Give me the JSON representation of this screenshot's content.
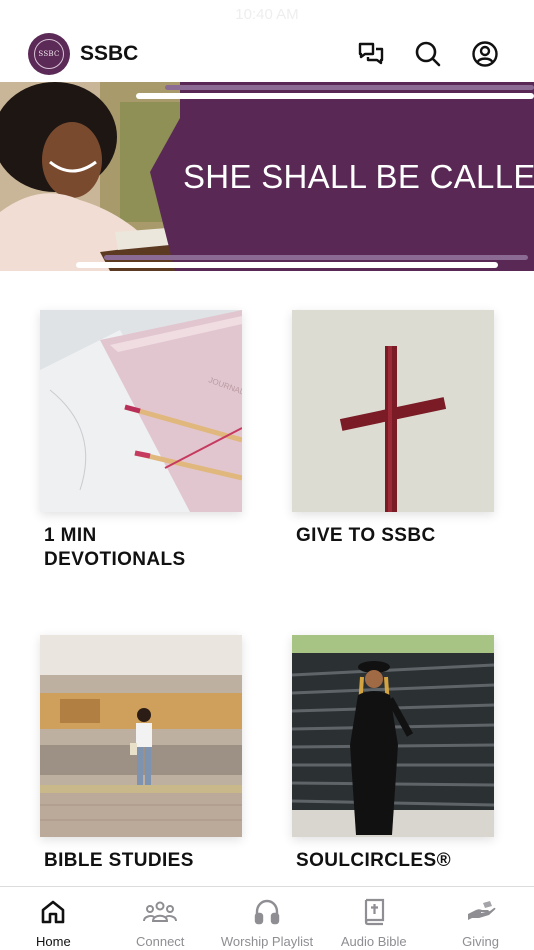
{
  "status_bar": {
    "time": "10:40 AM"
  },
  "header": {
    "logo_text": "SSBC",
    "title": "SSBC",
    "icons": [
      "chat-icon",
      "search-icon",
      "account-icon"
    ]
  },
  "banner": {
    "text": "SHE SHALL BE CALLED",
    "accent_color": "#5a2855"
  },
  "tiles": [
    {
      "label": "1 MIN DEVOTIONALS",
      "image": "journal-and-pencils"
    },
    {
      "label": "GIVE TO SSBC",
      "image": "wooden-cross"
    },
    {
      "label": "BIBLE STUDIES",
      "image": "woman-at-train-station"
    },
    {
      "label": "SOULCIRCLES®",
      "image": "woman-by-fence"
    }
  ],
  "tabbar": {
    "active": "Home",
    "tabs": [
      {
        "label": "Home",
        "icon": "home-icon"
      },
      {
        "label": "Connect",
        "icon": "people-icon"
      },
      {
        "label": "Worship Playlist",
        "icon": "headphones-icon"
      },
      {
        "label": "Audio Bible",
        "icon": "bible-icon"
      },
      {
        "label": "Giving",
        "icon": "giving-hand-icon"
      }
    ]
  }
}
